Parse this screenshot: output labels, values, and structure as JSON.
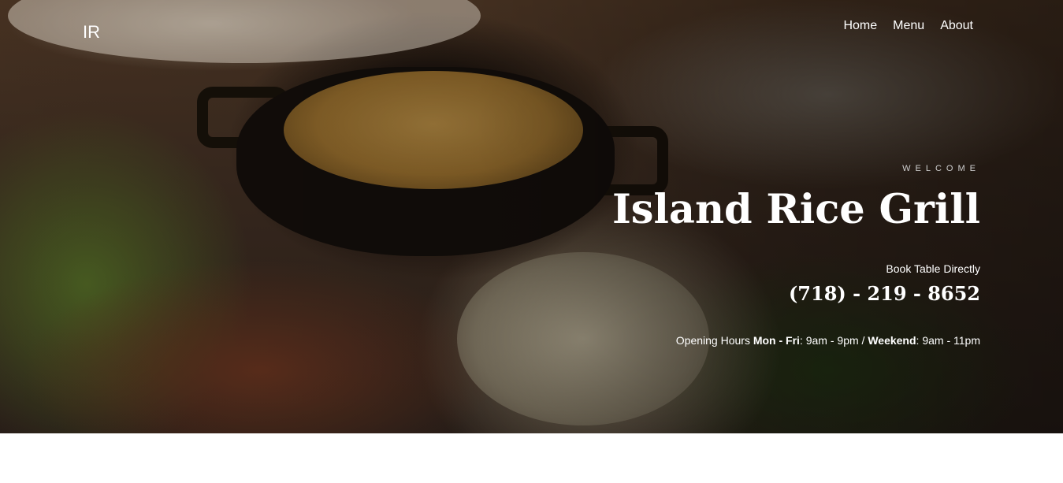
{
  "header": {
    "logo": "IR",
    "nav": [
      "Home",
      "Menu",
      "About"
    ]
  },
  "hero": {
    "welcome": "WELCOME",
    "title": "Island Rice Grill",
    "book_label": "Book Table Directly",
    "phone": "(718) - 219 - 8652",
    "hours": {
      "label": "Opening Hours",
      "weekday_days": "Mon - Fri",
      "weekday_hours": "9am - 9pm",
      "separator": "/",
      "weekend_days": "Weekend",
      "weekend_hours": "9am - 11pm"
    }
  }
}
